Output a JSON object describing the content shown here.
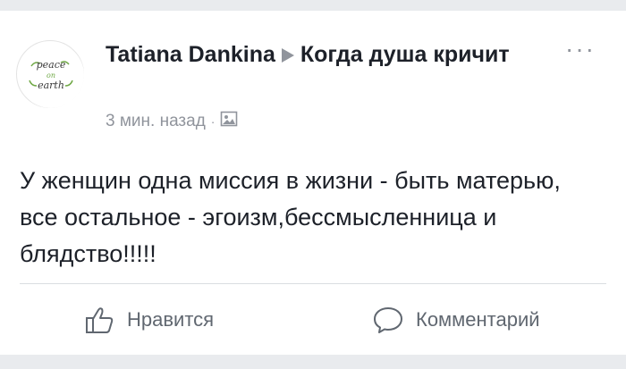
{
  "post": {
    "author": "Tatiana Dankina",
    "group": "Когда душа кричит",
    "timestamp": "3 мин. назад",
    "separator": "·",
    "text": "У женщин одна миссия в жизни - быть матерью, все остальное - эгоизм,бессмысленница и блядство!!!!!",
    "more_label": "···"
  },
  "avatar": {
    "logo_text": "peace on earth"
  },
  "actions": {
    "like_label": "Нравится",
    "comment_label": "Комментарий"
  },
  "colors": {
    "text": "#1d2129",
    "muted": "#90949c",
    "action": "#606770",
    "background": "#e9ebee"
  },
  "icons": [
    "like-icon",
    "comment-icon",
    "photo-privacy-icon",
    "play-arrow-icon",
    "more-icon"
  ]
}
